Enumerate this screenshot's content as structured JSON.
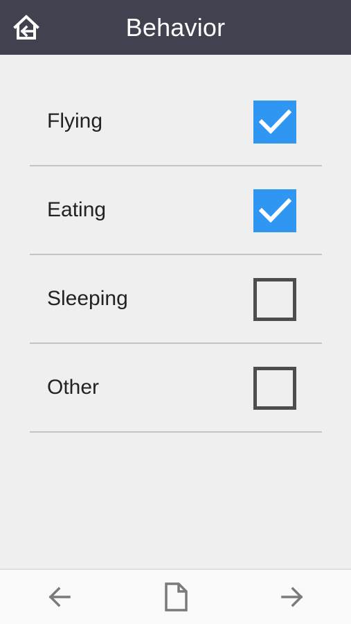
{
  "app_bar": {
    "title": "Behavior",
    "home_icon": "home-back-icon"
  },
  "behaviors": [
    {
      "label": "Flying",
      "checked": true
    },
    {
      "label": "Eating",
      "checked": true
    },
    {
      "label": "Sleeping",
      "checked": false
    },
    {
      "label": "Other",
      "checked": false
    }
  ],
  "bottom_nav": {
    "back_icon": "arrow-left-icon",
    "document_icon": "document-icon",
    "forward_icon": "arrow-right-icon"
  },
  "colors": {
    "app_bar": "#41424f",
    "background": "#efefef",
    "checkbox_checked": "#2f96f2",
    "checkbox_unchecked_border": "#4d4d4d",
    "divider": "#c4c4c4"
  }
}
